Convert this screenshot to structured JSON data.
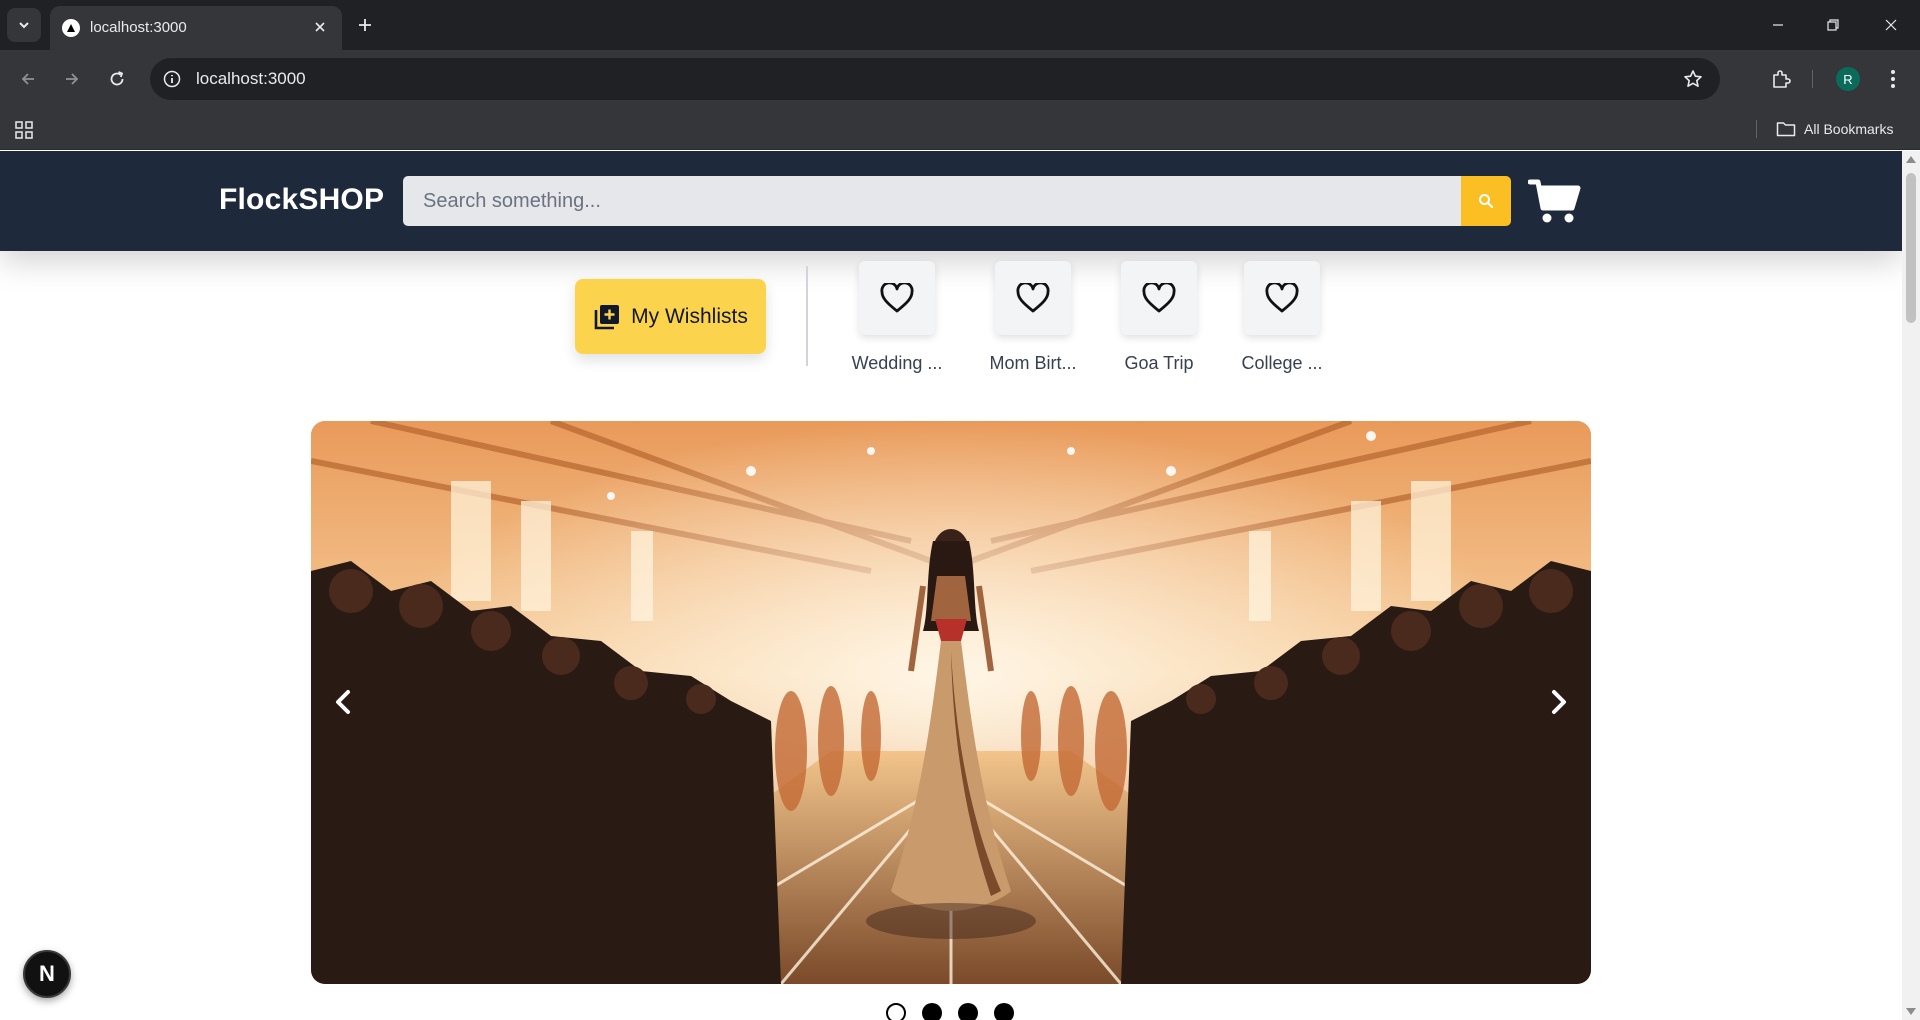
{
  "browser": {
    "tab": {
      "title": "localhost:3000"
    },
    "address": "localhost:3000",
    "bookmarks": {
      "all_label": "All Bookmarks"
    },
    "profile_initial": "R"
  },
  "header": {
    "brand": "FlockSHOP",
    "search_placeholder": "Search something...",
    "colors": {
      "background": "#1e293b",
      "accent": "#fbbf24"
    }
  },
  "wishlists": {
    "button_label": "My Wishlists",
    "items": [
      {
        "label": "Wedding ..."
      },
      {
        "label": "Mom Birt..."
      },
      {
        "label": "Goa Trip"
      },
      {
        "label": "College ..."
      }
    ]
  },
  "carousel": {
    "image": "fashion-runway-illustration",
    "slide_count": 4,
    "active_index": 0
  },
  "dev_badge": {
    "label": "N"
  }
}
